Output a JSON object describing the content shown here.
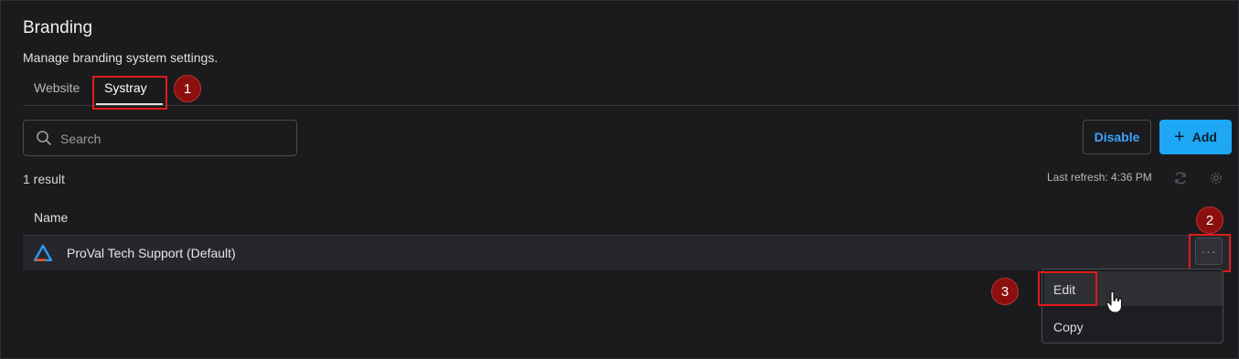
{
  "header": {
    "title": "Branding",
    "subtitle": "Manage branding system settings."
  },
  "tabs": [
    {
      "label": "Website",
      "active": false
    },
    {
      "label": "Systray",
      "active": true
    }
  ],
  "toolbar": {
    "search_placeholder": "Search",
    "disable_label": "Disable",
    "add_label": "Add"
  },
  "results": {
    "count_text": "1 result",
    "last_refresh": "Last refresh: 4:36 PM"
  },
  "table": {
    "columns": [
      "Name"
    ],
    "rows": [
      {
        "name": "ProVal Tech Support (Default)"
      }
    ]
  },
  "context_menu": {
    "items": [
      "Edit",
      "Copy"
    ]
  },
  "annotations": {
    "badges": [
      "1",
      "2",
      "3"
    ]
  },
  "colors": {
    "background": "#1b1b1d",
    "accent": "#1ea7f4",
    "highlight": "#e01b1b",
    "badge": "#8b0f0f"
  },
  "icons": [
    "search-icon",
    "plus-icon",
    "refresh-icon",
    "settings-icon",
    "proval-logo-icon",
    "more-options-icon",
    "hand-cursor-icon"
  ]
}
